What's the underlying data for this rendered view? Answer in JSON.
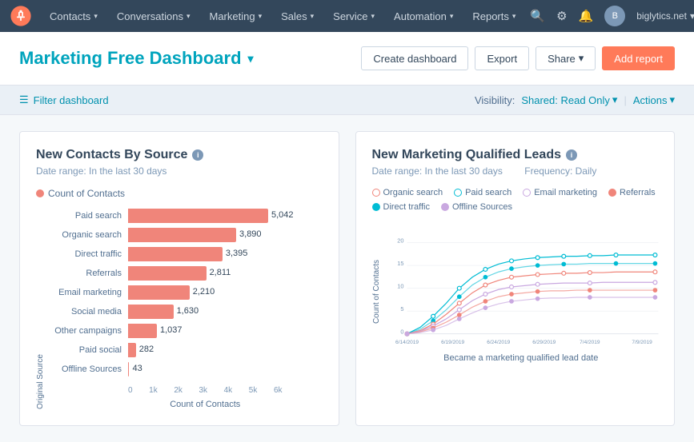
{
  "navbar": {
    "logo_label": "HubSpot",
    "items": [
      {
        "label": "Contacts",
        "id": "contacts"
      },
      {
        "label": "Conversations",
        "id": "conversations"
      },
      {
        "label": "Marketing",
        "id": "marketing"
      },
      {
        "label": "Sales",
        "id": "sales"
      },
      {
        "label": "Service",
        "id": "service"
      },
      {
        "label": "Automation",
        "id": "automation"
      },
      {
        "label": "Reports",
        "id": "reports"
      }
    ],
    "account": "biglytics.net"
  },
  "header": {
    "title": "Marketing Free Dashboard",
    "buttons": {
      "create": "Create dashboard",
      "export": "Export",
      "share": "Share",
      "add_report": "Add report"
    }
  },
  "filter_bar": {
    "filter_label": "Filter dashboard",
    "visibility_label": "Visibility:",
    "visibility_value": "Shared: Read Only",
    "actions_label": "Actions"
  },
  "chart1": {
    "title": "New Contacts By Source",
    "date_range": "Date range: In the last 30 days",
    "legend_label": "Count of Contacts",
    "legend_color": "#f0857a",
    "y_axis_label": "Original Source",
    "x_axis_label": "Count of Contacts",
    "x_ticks": [
      "0",
      "1k",
      "2k",
      "3k",
      "4k",
      "5k",
      "6k"
    ],
    "max_value": 5042,
    "bars": [
      {
        "label": "Paid search",
        "value": 5042,
        "display": "5,042"
      },
      {
        "label": "Organic search",
        "value": 3890,
        "display": "3,890"
      },
      {
        "label": "Direct traffic",
        "value": 3395,
        "display": "3,395"
      },
      {
        "label": "Referrals",
        "value": 2811,
        "display": "2,811"
      },
      {
        "label": "Email marketing",
        "value": 2210,
        "display": "2,210"
      },
      {
        "label": "Social media",
        "value": 1630,
        "display": "1,630"
      },
      {
        "label": "Other campaigns",
        "value": 1037,
        "display": "1,037"
      },
      {
        "label": "Paid social",
        "value": 282,
        "display": "282"
      },
      {
        "label": "Offline Sources",
        "value": 43,
        "display": "43"
      }
    ]
  },
  "chart2": {
    "title": "New Marketing Qualified Leads",
    "date_range": "Date range: In the last 30 days",
    "frequency": "Frequency: Daily",
    "y_axis_label": "Count of Contacts",
    "x_axis_label": "Became a marketing qualified lead date",
    "x_ticks": [
      "6/14/2019",
      "6/19/2019",
      "6/24/2019",
      "6/29/2019",
      "7/4/2019",
      "7/9/2019"
    ],
    "y_ticks": [
      "0",
      "5",
      "10",
      "15",
      "20"
    ],
    "legends": [
      {
        "label": "Organic search",
        "color": "#f0857a",
        "border": "#f0857a"
      },
      {
        "label": "Paid search",
        "color": "#00bcd4",
        "border": "#00bcd4"
      },
      {
        "label": "Email marketing",
        "color": "#c9a8e0",
        "border": "#c9a8e0"
      },
      {
        "label": "Referrals",
        "color": "#f0857a",
        "border": "#f0857a"
      },
      {
        "label": "Direct traffic",
        "color": "#00bcd4",
        "border": "#00bcd4"
      },
      {
        "label": "Offline Sources",
        "color": "#c9a8e0",
        "border": "#c9a8e0"
      }
    ]
  }
}
